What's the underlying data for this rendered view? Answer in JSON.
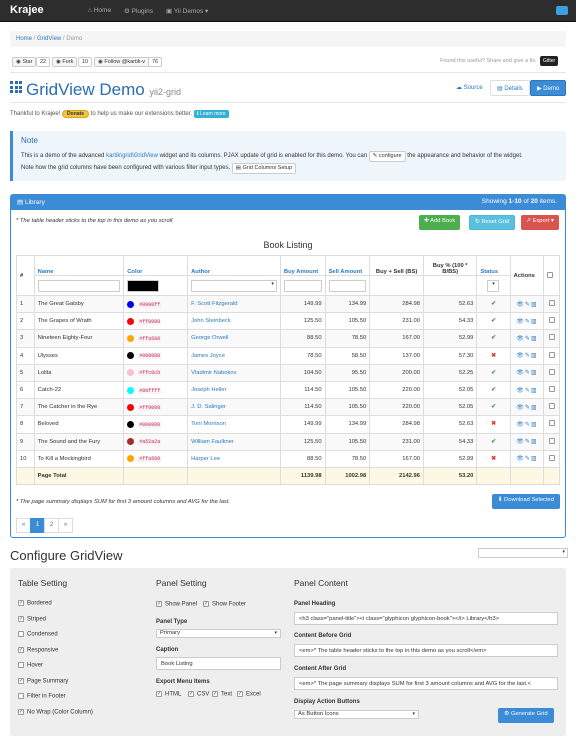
{
  "navbar": {
    "brand": "Krajee",
    "home": "Home",
    "plugins": "Plugins",
    "yii_demos": "Yii Demos"
  },
  "breadcrumb": {
    "home": "Home",
    "gridview": "GridView",
    "current": "Demo"
  },
  "github": {
    "star": "Star",
    "star_count": "22",
    "fork": "Fork",
    "fork_count": "10",
    "follow": "Follow @kartik-v",
    "follow_count": "76"
  },
  "found_useful": "Found this useful? Share and give a fix.",
  "gitter": "Gitter",
  "page": {
    "title": "GridView Demo",
    "subtitle": "yii2-grid",
    "source": "Source",
    "details": "Details",
    "demo": "Demo"
  },
  "thanks": {
    "text1": "Thankful to Krajee!",
    "donate": "Donate",
    "text2": "to help us make our extensions better.",
    "learn": "Learn more"
  },
  "note": {
    "title": "Note",
    "line1a": "This is a demo of the advanced",
    "link": "kartik\\grid\\GridView",
    "line1b": "widget and its columns. PJAX update of grid is enabled for this demo. You can",
    "configure": "configure",
    "line1c": "the appearance and behavior of the widget.",
    "line2": "Note how the grid columns have been configured with various filter input types.",
    "columns_setup": "Grid Columns Setup"
  },
  "panel": {
    "heading": "Library",
    "summary_pre": "Showing",
    "summary_range": "1-10",
    "summary_of": "of",
    "summary_total": "20",
    "summary_post": "items.",
    "before": "* The table header sticks to the top in this demo as you scroll",
    "add_book": "Add Book",
    "reset_grid": "Reset Grid",
    "export": "Export",
    "caption": "Book Listing",
    "after": "* The page summary displays SUM for first 3 amount columns and AVG for the last.",
    "download": "Download Selected"
  },
  "columns": {
    "num": "#",
    "name": "Name",
    "color": "Color",
    "author": "Author",
    "buy": "Buy Amount",
    "sell": "Sell Amount",
    "buysell": "Buy + Sell (BS)",
    "buypct": "Buy % (100 * B/BS)",
    "status": "Status",
    "actions": "Actions"
  },
  "rows": [
    {
      "n": "1",
      "name": "The Great Gatsby",
      "color": "#0000ff",
      "author": "F. Scott Fitzgerald",
      "buy": "149.99",
      "sell": "134.99",
      "bs": "284.98",
      "pct": "52.63",
      "status": "✔",
      "ok": true
    },
    {
      "n": "2",
      "name": "The Grapes of Wrath",
      "color": "#ff0000",
      "author": "John Steinbeck",
      "buy": "125.50",
      "sell": "105.50",
      "bs": "231.00",
      "pct": "54.33",
      "status": "✔",
      "ok": true
    },
    {
      "n": "3",
      "name": "Nineteen Eighty-Four",
      "color": "#ffa500",
      "author": "George Orwell",
      "buy": "88.50",
      "sell": "78.50",
      "bs": "167.00",
      "pct": "52.99",
      "status": "✔",
      "ok": true
    },
    {
      "n": "4",
      "name": "Ulysses",
      "color": "#000000",
      "author": "James Joyce",
      "buy": "78.50",
      "sell": "58.50",
      "bs": "137.00",
      "pct": "57.30",
      "status": "✖",
      "ok": false
    },
    {
      "n": "5",
      "name": "Lolita",
      "color": "#ffc0cb",
      "author": "Vladimir Nabokov",
      "buy": "104.50",
      "sell": "95.50",
      "bs": "200.00",
      "pct": "52.25",
      "status": "✔",
      "ok": true
    },
    {
      "n": "6",
      "name": "Catch-22",
      "color": "#00ffff",
      "author": "Joseph Heller",
      "buy": "114.50",
      "sell": "105.50",
      "bs": "220.00",
      "pct": "52.05",
      "status": "✔",
      "ok": true
    },
    {
      "n": "7",
      "name": "The Catcher in the Rye",
      "color": "#ff0000",
      "author": "J. D. Salinger",
      "buy": "114.50",
      "sell": "105.50",
      "bs": "220.00",
      "pct": "52.05",
      "status": "✔",
      "ok": true
    },
    {
      "n": "8",
      "name": "Beloved",
      "color": "#000000",
      "author": "Toni Morrison",
      "buy": "149.99",
      "sell": "134.99",
      "bs": "284.98",
      "pct": "52.63",
      "status": "✖",
      "ok": false
    },
    {
      "n": "9",
      "name": "The Sound and the Fury",
      "color": "#a52a2a",
      "author": "William Faulkner",
      "buy": "125.50",
      "sell": "105.50",
      "bs": "231.00",
      "pct": "54.33",
      "status": "✔",
      "ok": true
    },
    {
      "n": "10",
      "name": "To Kill a Mockingbird",
      "color": "#ffa500",
      "author": "Harper Lee",
      "buy": "88.50",
      "sell": "78.50",
      "bs": "167.00",
      "pct": "52.99",
      "status": "✖",
      "ok": false
    }
  ],
  "total": {
    "label": "Page Total",
    "buy": "1139.98",
    "sell": "1002.98",
    "bs": "2142.96",
    "pct": "53.20"
  },
  "pager": {
    "prev": "«",
    "p1": "1",
    "p2": "2",
    "next": "»"
  },
  "configure": {
    "title": "Configure GridView",
    "table_setting": "Table Setting",
    "panel_setting": "Panel Setting",
    "panel_content": "Panel Content",
    "table_opts": [
      "Bordered",
      "Striped",
      "Condensed",
      "Responsive",
      "Hover",
      "Page Summary",
      "Filter in Footer",
      "No Wrap (Color Column)"
    ],
    "show_panel": "Show Panel",
    "show_footer": "Show Footer",
    "panel_type_label": "Panel Type",
    "panel_type": "Primary",
    "caption_label": "Caption",
    "caption": "Book Listing",
    "export_label": "Export Menu Items",
    "export_items": [
      "HTML",
      "CSV",
      "Text",
      "Excel"
    ],
    "heading_label": "Panel Heading",
    "heading_value": "<h3 class=\"panel-title\"><i class=\"glyphicon glyphicon-book\"></i>  Library</h3>",
    "before_label": "Content Before Grid",
    "before_value": "<em>* The table header sticks to the top in this demo as you scroll</em>",
    "after_label": "Content After Grid",
    "after_value": "<em>* The page summary displays SUM for first 3 amount columns and AVG for the last.<",
    "action_label": "Display Action Buttons",
    "action_value": "As Button Icons",
    "generate": "Generate Grid"
  }
}
